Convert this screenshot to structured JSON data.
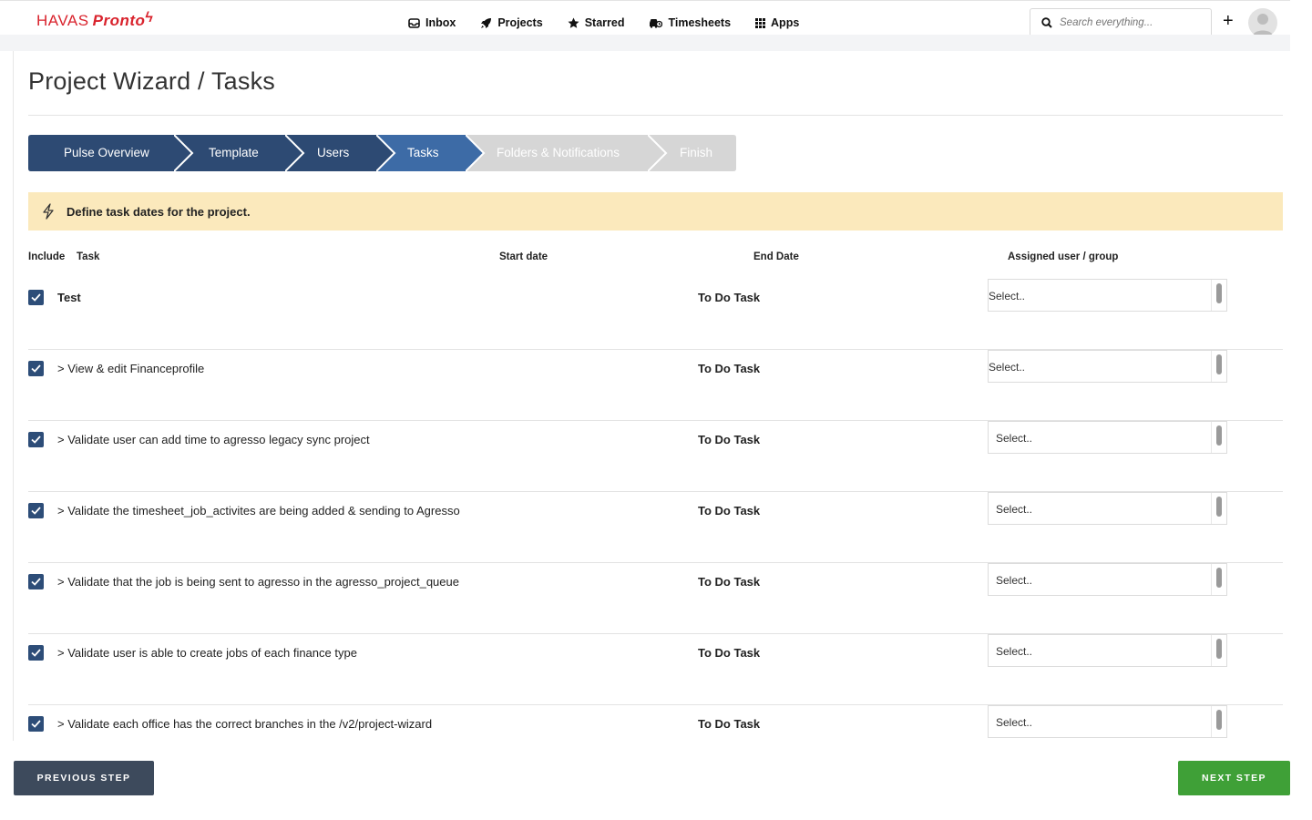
{
  "header": {
    "logo_havas": "HAVAS",
    "logo_pronto": "Pronto",
    "nav": [
      {
        "label": "Inbox",
        "icon": "inbox-icon"
      },
      {
        "label": "Projects",
        "icon": "rocket-icon"
      },
      {
        "label": "Starred",
        "icon": "star-icon"
      },
      {
        "label": "Timesheets",
        "icon": "car-clock-icon"
      },
      {
        "label": "Apps",
        "icon": "grid-icon"
      }
    ],
    "search_placeholder": "Search everything...",
    "add_label": "+"
  },
  "page": {
    "title": "Project Wizard / Tasks"
  },
  "wizard": {
    "steps": [
      {
        "label": "Pulse Overview",
        "state": "done"
      },
      {
        "label": "Template",
        "state": "done"
      },
      {
        "label": "Users",
        "state": "done"
      },
      {
        "label": "Tasks",
        "state": "active"
      },
      {
        "label": "Folders & Notifications",
        "state": "pending"
      },
      {
        "label": "Finish",
        "state": "pending"
      }
    ],
    "colors": {
      "done": "#2d4a73",
      "active": "#3d6ba6",
      "pending": "#d6d6d6"
    }
  },
  "alert": {
    "text": "Define task dates for the project.",
    "icon": "bolt-icon"
  },
  "table": {
    "headers": {
      "include": "Include",
      "task": "Task",
      "start": "Start date",
      "end": "End Date",
      "assigned": "Assigned user / group"
    },
    "rows": [
      {
        "task": "Test",
        "type": "To Do Task",
        "assigned": "Select..",
        "checked": true
      },
      {
        "task": "> View & edit Financeprofile",
        "type": "To Do Task",
        "assigned": "Select..",
        "checked": true
      },
      {
        "task": "> Validate user can add time to agresso legacy sync project",
        "type": "To Do Task",
        "assigned": "Select..",
        "checked": true
      },
      {
        "task": "> Validate the timesheet_job_activites are being added & sending to Agresso",
        "type": "To Do Task",
        "assigned": "Select..",
        "checked": true
      },
      {
        "task": "> Validate that the job is being sent to agresso in the agresso_project_queue",
        "type": "To Do Task",
        "assigned": "Select..",
        "checked": true
      },
      {
        "task": "> Validate user is able to create jobs of each finance type",
        "type": "To Do Task",
        "assigned": "Select..",
        "checked": true
      },
      {
        "task": "> Validate each office has the correct branches in the /v2/project-wizard",
        "type": "To Do Task",
        "assigned": "Select..",
        "checked": true
      }
    ]
  },
  "footer": {
    "previous_label": "PREVIOUS STEP",
    "next_label": "NEXT STEP"
  }
}
